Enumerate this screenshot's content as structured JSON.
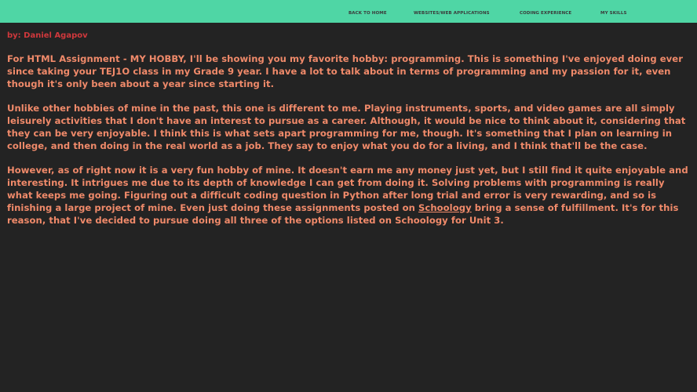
{
  "nav": {
    "home": "BACK TO HOME",
    "websites": "WEBSITES/WEB APPLICATIONS",
    "experience": "CODING EXPERIENCE",
    "skills": "MY SKILLS"
  },
  "byline": "by: Daniel Agapov",
  "paragraphs": {
    "p1": "For HTML Assignment - MY HOBBY, I'll be showing you my favorite hobby: programming. This is something I've enjoyed doing ever since taking your TEJ1O class in my Grade 9 year. I have a lot to talk about in terms of programming and my passion for it, even though it's only been about a year since starting it.",
    "p2": "Unlike other hobbies of mine in the past, this one is different to me. Playing instruments, sports, and video games are all simply leisurely activities that I don't have an interest to pursue as a career. Although, it would be nice to think about it, considering that they can be very enjoyable. I think this is what sets apart programming for me, though. It's something that I plan on learning in college, and then doing in the real world as a job. They say to enjoy what you do for a living, and I think that'll be the case.",
    "p3_before": "However, as of right now it is a very fun hobby of mine. It doesn't earn me any money just yet, but I still find it quite enjoyable and interesting. It intrigues me due to its depth of knowledge I can get from doing it. Solving problems with programming is really what keeps me going. Figuring out a difficult coding question in Python after long trial and error is very rewarding, and so is finishing a large project of mine. Even just doing these assignments posted on ",
    "p3_link": "Schoology",
    "p3_after": " bring a sense of fulfillment. It's for this reason, that I've decided to pursue doing all three of the options listed on Schoology for Unit 3."
  },
  "colors": {
    "navbar": "#4fd6a5",
    "background": "#232323",
    "byline": "#d0383c",
    "text": "#f08a6a"
  }
}
